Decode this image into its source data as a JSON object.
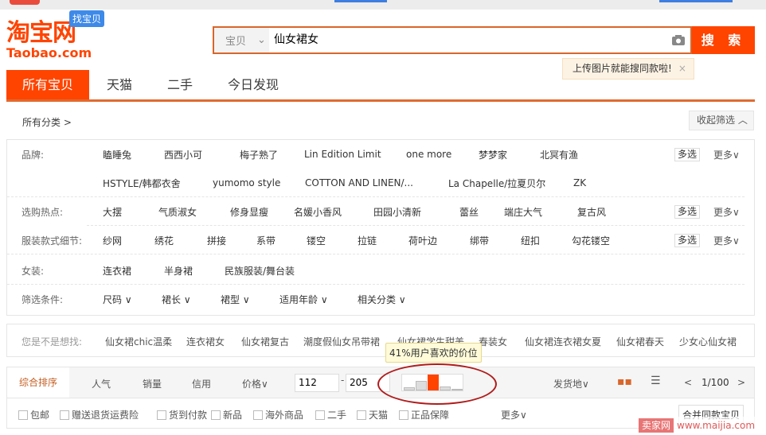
{
  "logo": {
    "cn": "淘宝网",
    "en": "Taobao.com",
    "tag": "找宝贝"
  },
  "search": {
    "category": "宝贝",
    "query": "仙女裙女",
    "button": "搜 索",
    "image_tip": "上传图片就能搜同款啦!",
    "close": "×"
  },
  "nav_tabs": [
    "所有宝贝",
    "天猫",
    "二手",
    "今日发现"
  ],
  "breadcrumb": "所有分类 >",
  "collapse_filter": "收起筛选 ︿",
  "filters": [
    {
      "label": "品牌:",
      "items": [
        "瞌睡兔",
        "西西小可",
        "梅子熟了",
        "Lin Edition Limit",
        "one more",
        "梦梦家",
        "北冥有渔"
      ],
      "multi": "多选",
      "more": "更多∨"
    },
    {
      "label": "",
      "items": [
        "HSTYLE/韩都衣舍",
        "yumomo style",
        "COTTON AND LINEN/...",
        "La Chapelle/拉夏贝尔",
        "ZK"
      ]
    },
    {
      "label": "选购热点:",
      "items": [
        "大摆",
        "气质淑女",
        "修身显瘦",
        "名媛小香风",
        "田园小清新",
        "蕾丝",
        "端庄大气",
        "复古风"
      ],
      "multi": "多选",
      "more": "更多∨"
    },
    {
      "label": "服装款式细节:",
      "items": [
        "纱网",
        "绣花",
        "拼接",
        "系带",
        "镂空",
        "拉链",
        "荷叶边",
        "绑带",
        "纽扣",
        "勾花镂空"
      ],
      "multi": "多选",
      "more": "更多∨"
    },
    {
      "label": "女装:",
      "items": [
        "连衣裙",
        "半身裙",
        "民族服装/舞台装"
      ]
    },
    {
      "label": "筛选条件:",
      "items": [
        "尺码 ∨",
        "裙长 ∨",
        "裙型 ∨",
        "适用年龄 ∨",
        "相关分类 ∨"
      ]
    }
  ],
  "suggest": {
    "label": "您是不是想找:",
    "items": [
      "仙女裙chic温柔",
      "连衣裙女",
      "仙女裙复古",
      "潮度假仙女吊带裙",
      "仙女裙学生甜美",
      "春装女",
      "仙女裙连衣裙女夏",
      "仙女裙春天",
      "少女心仙女裙"
    ]
  },
  "price_tip": "41%用户喜欢的价位",
  "sort": {
    "items": [
      "综合排序",
      "人气",
      "销量",
      "信用",
      "价格∨"
    ],
    "price_min": "112",
    "price_dash": "-",
    "price_max": "205",
    "location": "发货地∨",
    "page": "1/100",
    "prev": "<",
    "next": ">"
  },
  "price_histogram": {
    "values": [
      1,
      3,
      5,
      1.2,
      0.5
    ],
    "highlight_index": 2,
    "highlight_color": "#ff4400"
  },
  "options": {
    "items": [
      "包邮",
      "赠送退货运费险",
      "货到付款",
      "新品",
      "海外商品",
      "二手",
      "天猫",
      "正品保障"
    ],
    "more": "更多∨",
    "merge": "合并同款宝贝"
  },
  "watermark": {
    "brand": "卖家网",
    "url": "www.maijia.com"
  }
}
